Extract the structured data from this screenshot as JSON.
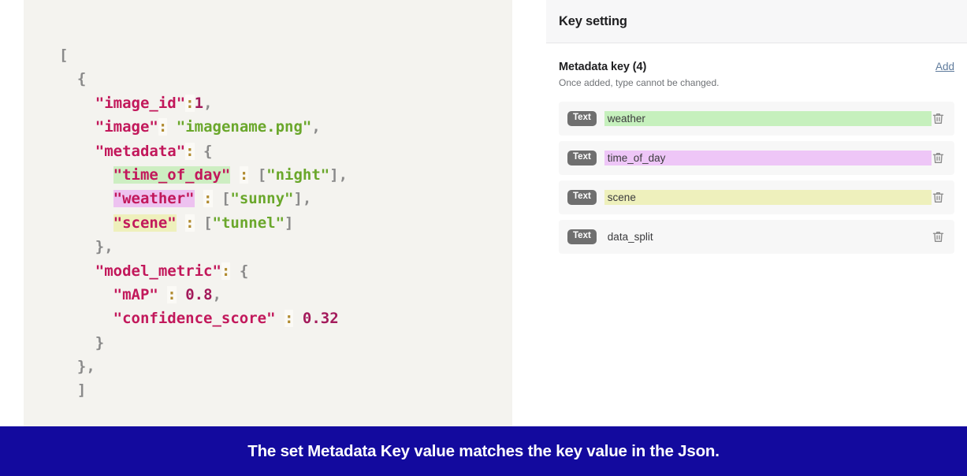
{
  "code_sample": {
    "language": "json",
    "lines": [
      [
        {
          "t": "[",
          "c": "punct"
        }
      ],
      [
        {
          "t": "  {",
          "c": "punct"
        }
      ],
      [
        {
          "t": "    ",
          "c": "plain"
        },
        {
          "t": "\"image_id\"",
          "c": "key"
        },
        {
          "t": ":",
          "c": "colon"
        },
        {
          "t": "1",
          "c": "num"
        },
        {
          "t": ",",
          "c": "punct"
        }
      ],
      [
        {
          "t": "    ",
          "c": "plain"
        },
        {
          "t": "\"image\"",
          "c": "key"
        },
        {
          "t": ":",
          "c": "colon"
        },
        {
          "t": " ",
          "c": "plain"
        },
        {
          "t": "\"imagename.png\"",
          "c": "str"
        },
        {
          "t": ",",
          "c": "punct"
        }
      ],
      [
        {
          "t": "    ",
          "c": "plain"
        },
        {
          "t": "\"metadata\"",
          "c": "key"
        },
        {
          "t": ":",
          "c": "colon"
        },
        {
          "t": " {",
          "c": "punct"
        }
      ],
      [
        {
          "t": "      ",
          "c": "plain"
        },
        {
          "t": "\"time_of_day\"",
          "c": "key",
          "hl": "green"
        },
        {
          "t": " ",
          "c": "plain"
        },
        {
          "t": ":",
          "c": "colon"
        },
        {
          "t": " [",
          "c": "punct"
        },
        {
          "t": "\"night\"",
          "c": "str"
        },
        {
          "t": "],",
          "c": "punct"
        }
      ],
      [
        {
          "t": "      ",
          "c": "plain"
        },
        {
          "t": "\"weather\"",
          "c": "key",
          "hl": "purple"
        },
        {
          "t": " ",
          "c": "plain"
        },
        {
          "t": ":",
          "c": "colon"
        },
        {
          "t": " [",
          "c": "punct"
        },
        {
          "t": "\"sunny\"",
          "c": "str"
        },
        {
          "t": "],",
          "c": "punct"
        }
      ],
      [
        {
          "t": "      ",
          "c": "plain"
        },
        {
          "t": "\"scene\"",
          "c": "key",
          "hl": "yellow"
        },
        {
          "t": " ",
          "c": "plain"
        },
        {
          "t": ":",
          "c": "colon"
        },
        {
          "t": " [",
          "c": "punct"
        },
        {
          "t": "\"tunnel\"",
          "c": "str"
        },
        {
          "t": "]",
          "c": "punct"
        }
      ],
      [
        {
          "t": "    },",
          "c": "punct"
        }
      ],
      [
        {
          "t": "    ",
          "c": "plain"
        },
        {
          "t": "\"model_metric\"",
          "c": "key"
        },
        {
          "t": ":",
          "c": "colon"
        },
        {
          "t": " {",
          "c": "punct"
        }
      ],
      [
        {
          "t": "      ",
          "c": "plain"
        },
        {
          "t": "\"mAP\"",
          "c": "key"
        },
        {
          "t": " ",
          "c": "plain"
        },
        {
          "t": ":",
          "c": "colon"
        },
        {
          "t": " ",
          "c": "plain"
        },
        {
          "t": "0.8",
          "c": "num"
        },
        {
          "t": ",",
          "c": "punct"
        }
      ],
      [
        {
          "t": "      ",
          "c": "plain"
        },
        {
          "t": "\"confidence_score\"",
          "c": "key"
        },
        {
          "t": " ",
          "c": "plain"
        },
        {
          "t": ":",
          "c": "colon"
        },
        {
          "t": " ",
          "c": "plain"
        },
        {
          "t": "0.32",
          "c": "num"
        }
      ],
      [
        {
          "t": "    }",
          "c": "punct"
        }
      ],
      [
        {
          "t": "  },",
          "c": "punct"
        }
      ],
      [
        {
          "t": "  ]",
          "c": "punct"
        }
      ]
    ]
  },
  "key_panel": {
    "header_title": "Key setting",
    "section_title": "Metadata key (4)",
    "section_subtitle": "Once added, type cannot be changed.",
    "add_label": "Add",
    "rows": [
      {
        "type_label": "Text",
        "name": "weather",
        "swatch": "green",
        "delete_icon": "trash-icon"
      },
      {
        "type_label": "Text",
        "name": "time_of_day",
        "swatch": "purple",
        "delete_icon": "trash-icon"
      },
      {
        "type_label": "Text",
        "name": "scene",
        "swatch": "yellow",
        "delete_icon": "trash-icon"
      },
      {
        "type_label": "Text",
        "name": "data_split",
        "swatch": "none",
        "delete_icon": "trash-icon"
      }
    ]
  },
  "caption": {
    "text": "The set Metadata Key value matches the key value in the Json."
  },
  "colors": {
    "banner_blue": "#130a9e",
    "code_background": "#f4f3ef",
    "highlight_green": "#cdeec2",
    "highlight_purple": "#edc2f0",
    "highlight_yellow": "#eef0bc",
    "json_key": "#c2185b",
    "json_string": "#6aa72b",
    "badge_gray": "#6f6f6f",
    "add_link": "#5f7b9c"
  }
}
